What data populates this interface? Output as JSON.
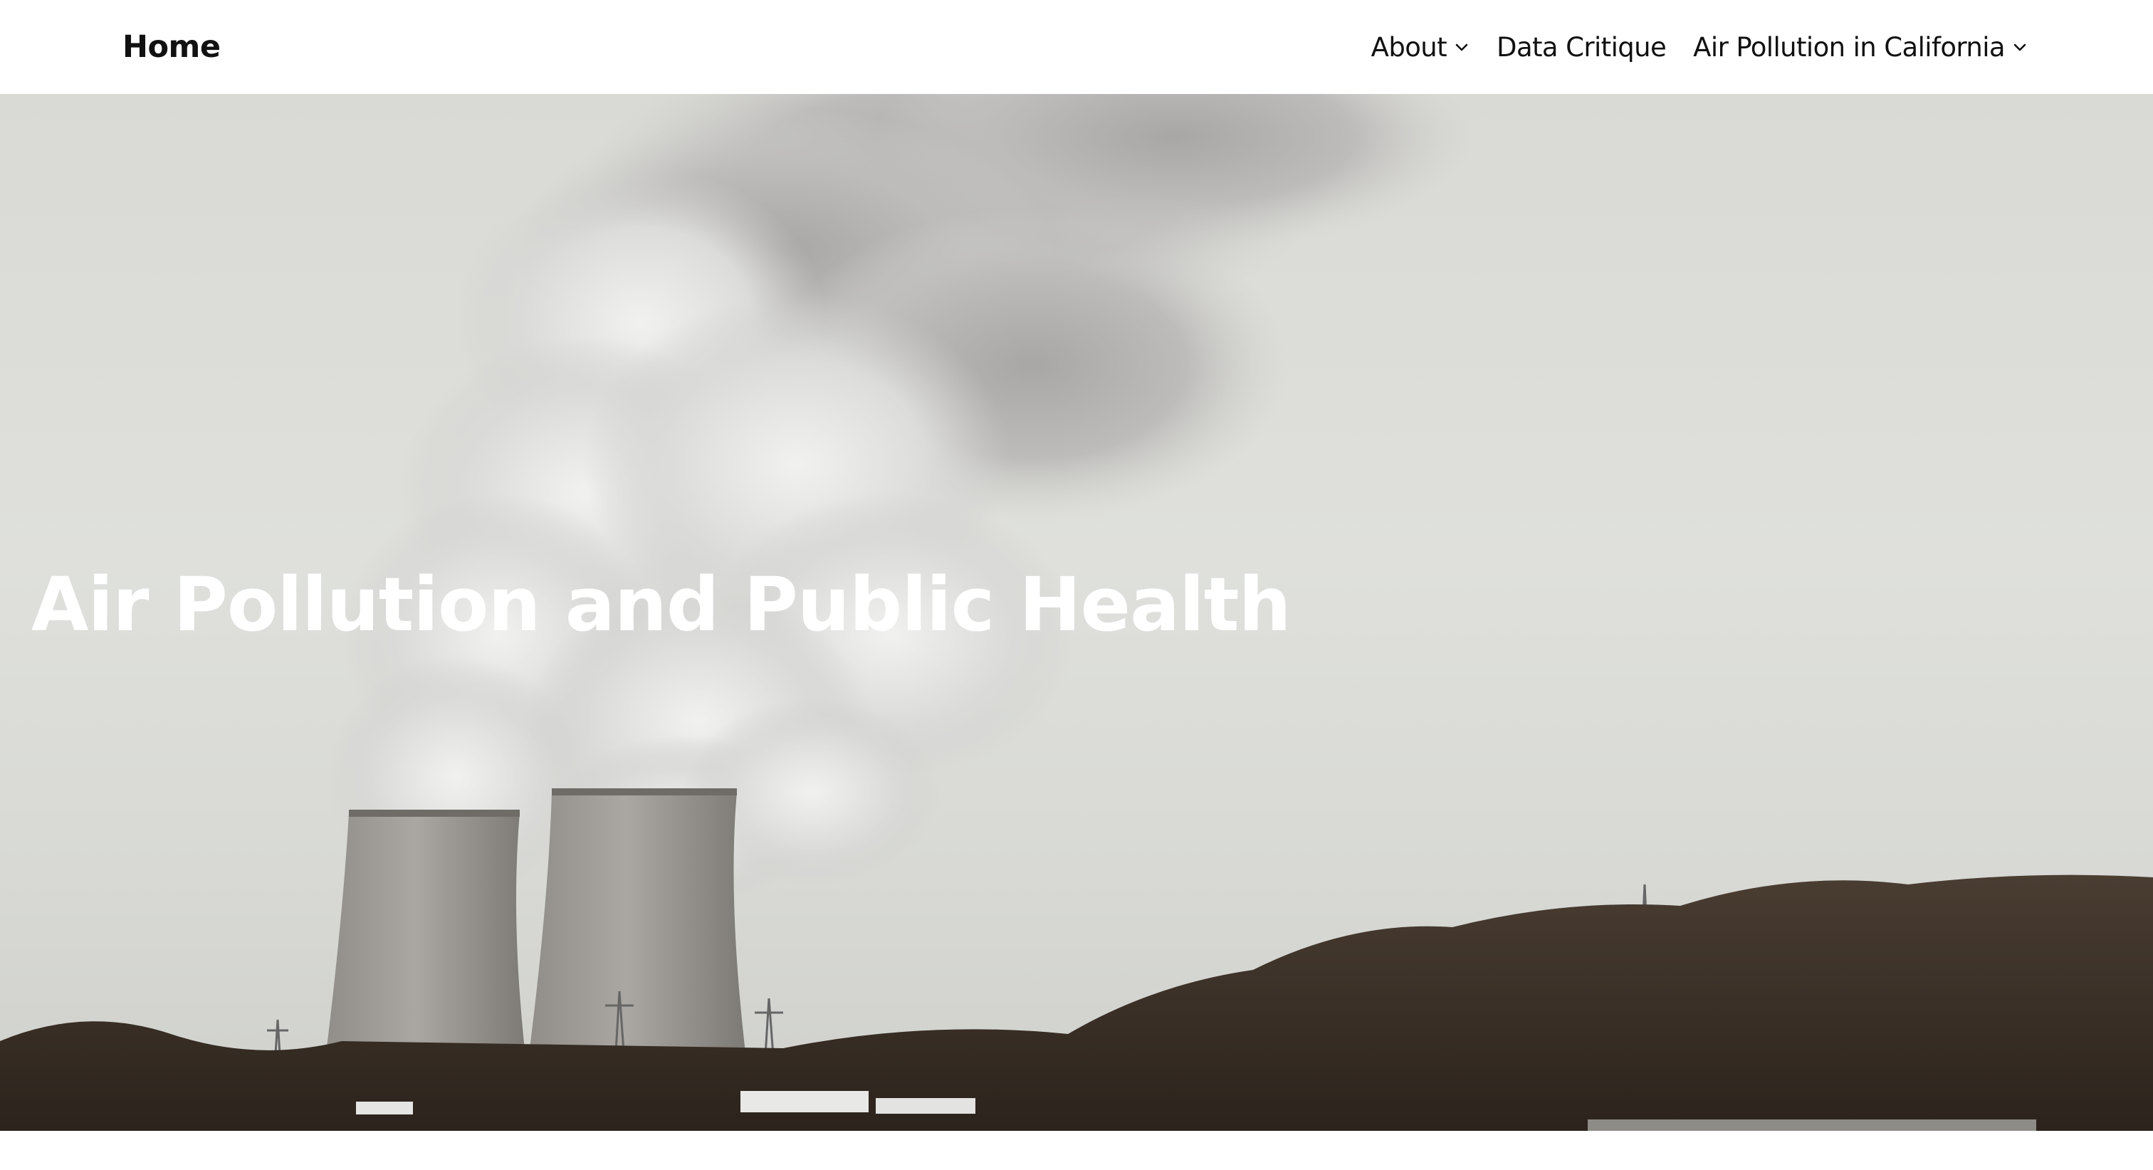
{
  "header": {
    "site_title": "Home",
    "nav": [
      {
        "label": "About",
        "has_dropdown": true,
        "icon": "chevron-down-icon"
      },
      {
        "label": "Data Critique",
        "has_dropdown": false
      },
      {
        "label": "Air Pollution in California",
        "has_dropdown": true,
        "icon": "chevron-down-icon"
      }
    ]
  },
  "hero": {
    "title": "Air Pollution and Public Health",
    "image": "cooling-towers-smoke-photo"
  },
  "colors": {
    "header_bg": "#ffffff",
    "text_dark": "#111111",
    "hero_title": "#ffffff",
    "sky": "#dcddd9",
    "smoke": "#c9c8c6",
    "tower": "#9a9894",
    "trees": "#3b3128"
  }
}
